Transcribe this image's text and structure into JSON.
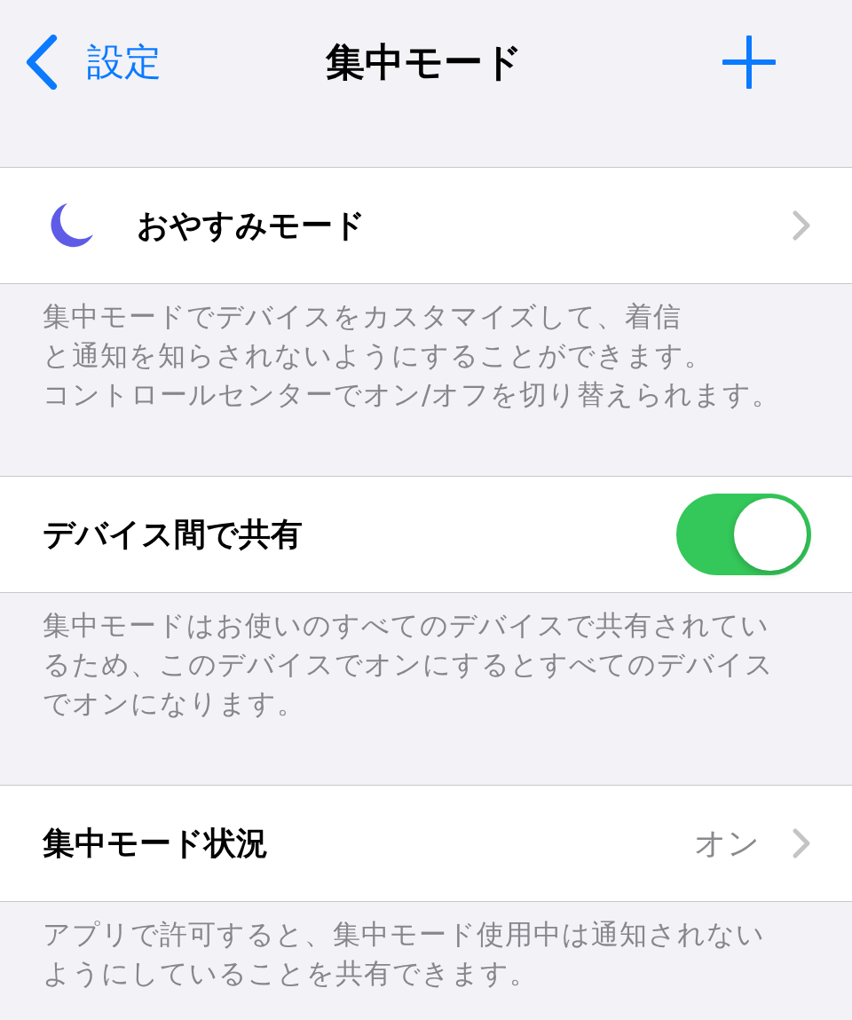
{
  "nav": {
    "back_label": "設定",
    "title": "集中モード"
  },
  "groups": [
    {
      "rows": [
        {
          "kind": "mode",
          "label": "おやすみモード"
        }
      ],
      "footer_lines": [
        "集中モードでデバイスをカスタマイズして、着信",
        "と通知を知らされないようにすることができます。",
        "コントロールセンターでオン/オフを切り替えられます。"
      ]
    },
    {
      "rows": [
        {
          "kind": "toggle",
          "label": "デバイス間で共有",
          "on": true
        }
      ],
      "footer_lines": [
        "集中モードはお使いのすべてのデバイスで共有されてい",
        "るため、このデバイスでオンにするとすべてのデバイス",
        "でオンになります。"
      ]
    },
    {
      "rows": [
        {
          "kind": "link",
          "label": "集中モード状況",
          "value": "オン"
        }
      ],
      "footer_lines": [
        "アプリで許可すると、集中モード使用中は通知されない",
        "ようにしていることを共有できます。"
      ]
    }
  ]
}
